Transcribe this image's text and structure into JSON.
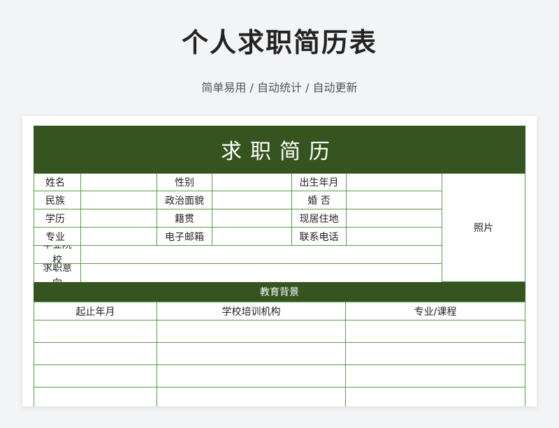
{
  "header": {
    "title": "个人求职简历表",
    "subtitle": "简单易用 / 自动统计 / 自动更新"
  },
  "form": {
    "banner": "求职简历",
    "labels": {
      "name": "姓名",
      "gender": "性别",
      "birth": "出生年月",
      "ethnicity": "民族",
      "politics": "政治面貌",
      "marriage": "婚 否",
      "education": "学历",
      "native_place": "籍贯",
      "address": "现居住地",
      "major": "专业",
      "email": "电子邮箱",
      "phone": "联系电话",
      "school": "毕业院校",
      "intent": "求职意向",
      "photo": "照片"
    },
    "education_section": {
      "title": "教育背景",
      "columns": [
        "起止年月",
        "学校培训机构",
        "专业/课程"
      ]
    }
  }
}
